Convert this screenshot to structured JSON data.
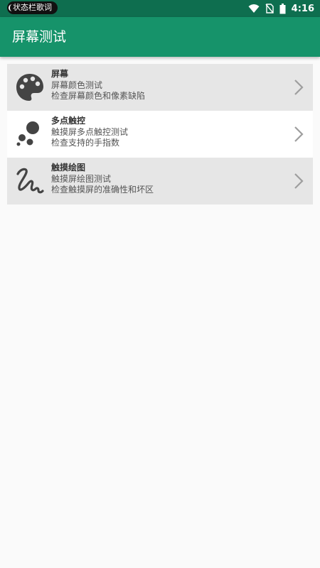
{
  "status_bar": {
    "badge": "状态栏歌词",
    "time": "4:16",
    "icons": [
      "wifi-icon",
      "no-sim-icon",
      "battery-icon"
    ]
  },
  "app_bar": {
    "title": "屏幕测试",
    "color": "#16936a"
  },
  "items": [
    {
      "icon": "palette-icon",
      "title": "屏幕",
      "line1": "屏幕颜色测试",
      "line2": "检查屏幕颜色和像素缺陷"
    },
    {
      "icon": "multi-touch-icon",
      "title": "多点触控",
      "line1": "触摸屏多点触控测试",
      "line2": "检查支持的手指数"
    },
    {
      "icon": "gesture-icon",
      "title": "触摸绘图",
      "line1": "触摸屏绘图测试",
      "line2": "检查触摸屏的准确性和坏区"
    }
  ]
}
